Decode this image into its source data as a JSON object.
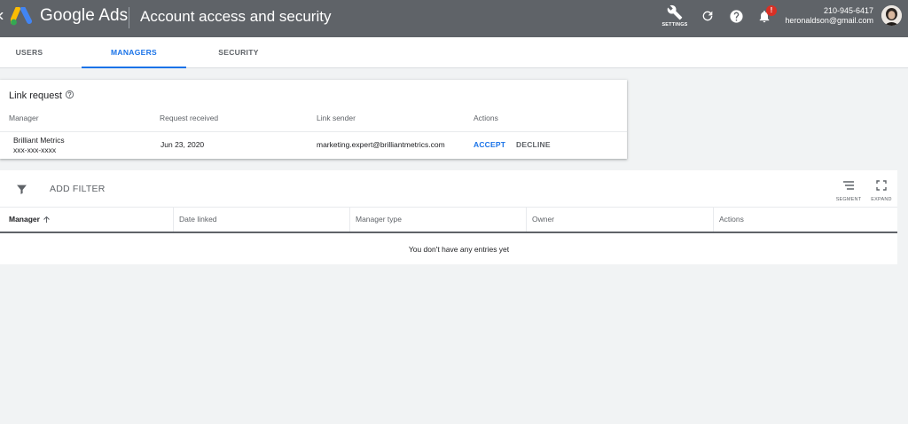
{
  "header": {
    "brand": "Google Ads",
    "page_title": "Account access and security",
    "settings_label": "SETTINGS",
    "notification_badge": "!",
    "account_phone": "210-945-6417",
    "account_email": "heronaldson@gmail.com"
  },
  "tabs": [
    {
      "label": "USERS",
      "active": false
    },
    {
      "label": "MANAGERS",
      "active": true
    },
    {
      "label": "SECURITY",
      "active": false
    }
  ],
  "link_request": {
    "title": "Link request",
    "columns": [
      "Manager",
      "Request received",
      "Link sender",
      "Actions"
    ],
    "row": {
      "manager_name": "Brilliant Metrics",
      "manager_id": "xxx-xxx-xxxx",
      "request_received": "Jun 23, 2020",
      "link_sender": "marketing.expert@brilliantmetrics.com",
      "accept_label": "ACCEPT",
      "decline_label": "DECLINE"
    }
  },
  "managers_table": {
    "add_filter_label": "ADD FILTER",
    "segment_label": "SEGMENT",
    "expand_label": "EXPAND",
    "columns": [
      "Manager",
      "Date linked",
      "Manager type",
      "Owner",
      "Actions"
    ],
    "empty_message": "You don't have any entries yet"
  },
  "colors": {
    "header_bg": "#5f6368",
    "accent": "#1a73e8",
    "badge": "#d93025"
  }
}
